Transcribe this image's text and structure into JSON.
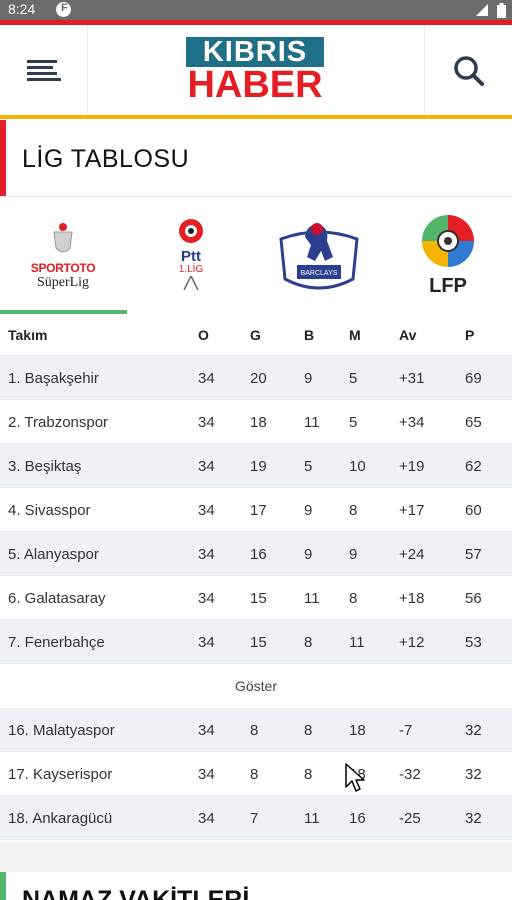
{
  "status_bar": {
    "time": "8:24",
    "app_badge_letter": "F"
  },
  "header": {
    "logo_top": "KIBRIS",
    "logo_bottom": "HABER",
    "menu_icon": "hamburger-menu-icon",
    "search_icon": "search-icon"
  },
  "section": {
    "title": "LİG TABLOSU"
  },
  "leagues": [
    {
      "name_line1": "SPORTOTO",
      "name_line2": "SüperLig",
      "icon": "sportoto-superlig-logo",
      "active": true
    },
    {
      "name_line1": "Ptt",
      "name_line2": "1.LİG",
      "icon": "ptt-1-lig-logo",
      "active": false
    },
    {
      "name_line1": "BARCLAYS",
      "icon": "premier-league-logo",
      "active": false
    },
    {
      "name_line1": "LFP",
      "icon": "lfp-logo",
      "active": false
    }
  ],
  "table": {
    "headers": {
      "team": "Takım",
      "o": "O",
      "g": "G",
      "b": "B",
      "m": "M",
      "av": "Av",
      "p": "P"
    },
    "rows": [
      {
        "team": "1. Başakşehir",
        "o": "34",
        "g": "20",
        "b": "9",
        "m": "5",
        "av": "+31",
        "p": "69"
      },
      {
        "team": "2. Trabzonspor",
        "o": "34",
        "g": "18",
        "b": "11",
        "m": "5",
        "av": "+34",
        "p": "65"
      },
      {
        "team": "3. Beşiktaş",
        "o": "34",
        "g": "19",
        "b": "5",
        "m": "10",
        "av": "+19",
        "p": "62"
      },
      {
        "team": "4. Sivasspor",
        "o": "34",
        "g": "17",
        "b": "9",
        "m": "8",
        "av": "+17",
        "p": "60"
      },
      {
        "team": "5. Alanyaspor",
        "o": "34",
        "g": "16",
        "b": "9",
        "m": "9",
        "av": "+24",
        "p": "57"
      },
      {
        "team": "6. Galatasaray",
        "o": "34",
        "g": "15",
        "b": "11",
        "m": "8",
        "av": "+18",
        "p": "56"
      },
      {
        "team": "7. Fenerbahçe",
        "o": "34",
        "g": "15",
        "b": "8",
        "m": "11",
        "av": "+12",
        "p": "53"
      }
    ],
    "show_more_label": "Göster",
    "bottom_rows": [
      {
        "team": "16. Malatyaspor",
        "o": "34",
        "g": "8",
        "b": "8",
        "m": "18",
        "av": "-7",
        "p": "32"
      },
      {
        "team": "17. Kayserispor",
        "o": "34",
        "g": "8",
        "b": "8",
        "m": "18",
        "av": "-32",
        "p": "32"
      },
      {
        "team": "18. Ankaragücü",
        "o": "34",
        "g": "7",
        "b": "11",
        "m": "16",
        "av": "-25",
        "p": "32"
      }
    ]
  },
  "next_section": {
    "title": "NAMAZ VAKİTLERİ"
  },
  "colors": {
    "brand_red": "#e31e24",
    "brand_teal": "#1f6f86",
    "accent_yellow": "#f4b400",
    "active_tab_green": "#53b66d",
    "row_shade": "#eef2f7"
  }
}
